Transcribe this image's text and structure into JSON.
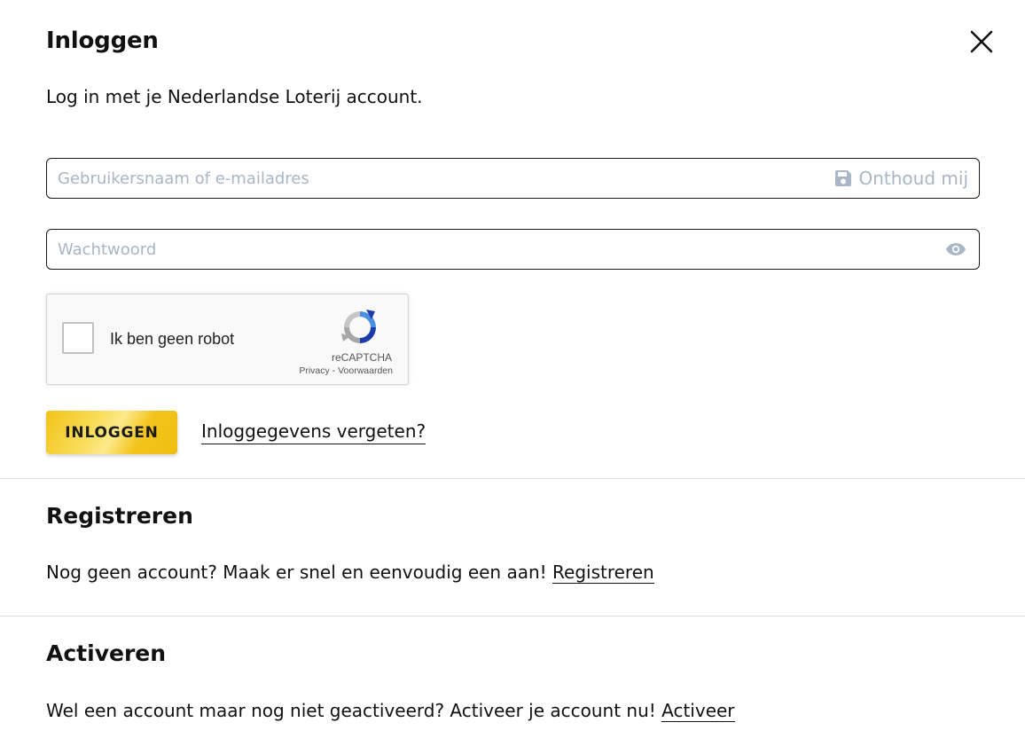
{
  "login": {
    "title": "Inloggen",
    "intro": "Log in met je Nederlandse Loterij account.",
    "username": {
      "placeholder": "Gebruikersnaam of e-mailadres",
      "value": ""
    },
    "remember_label": "Onthoud mij",
    "password": {
      "placeholder": "Wachtwoord",
      "value": ""
    },
    "captcha": {
      "label": "Ik ben geen robot",
      "brand": "reCAPTCHA",
      "privacy": "Privacy",
      "separator": " - ",
      "terms": "Voorwaarden"
    },
    "submit_label": "INLOGGEN",
    "forgot_link": "Inloggegevens vergeten?"
  },
  "register": {
    "title": "Registreren",
    "text": "Nog geen account? Maak er snel en eenvoudig een aan! ",
    "link": "Registreren"
  },
  "activate": {
    "title": "Activeren",
    "text": "Wel een account maar nog niet geactiveerd? Activeer je account nu! ",
    "link": "Activeer"
  },
  "icons": {
    "close": "close-icon",
    "remember": "save-icon",
    "password_toggle": "eye-icon",
    "captcha": "recaptcha-logo-icon"
  },
  "colors": {
    "accent": "#f2c318",
    "placeholder": "#a9b6c6",
    "text": "#111111",
    "divider": "#dedede"
  }
}
